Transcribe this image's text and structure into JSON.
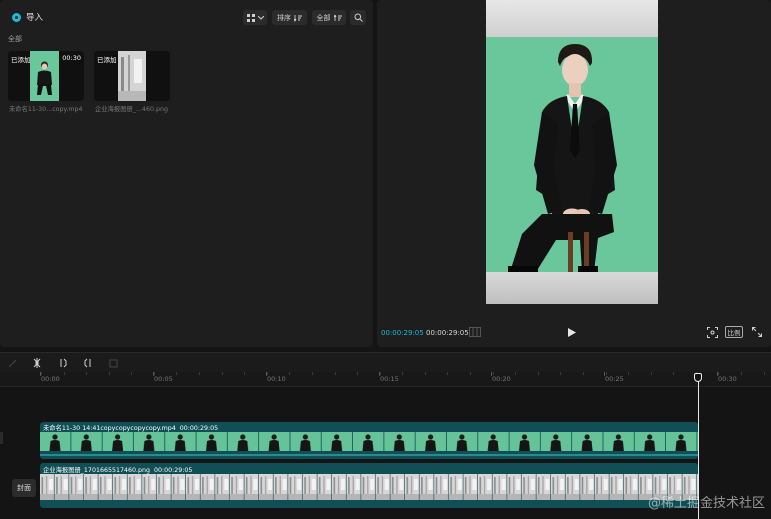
{
  "media": {
    "import_label": "导入",
    "sort_label": "排序",
    "filter_label": "全部",
    "all_label": "全部",
    "items": [
      {
        "badge": "已添加",
        "duration": "00:30",
        "name": "未命名11-30...copy.mp4"
      },
      {
        "badge": "已添加",
        "duration": "",
        "name": "企业海报图册_...460.png"
      }
    ]
  },
  "preview": {
    "current_time": "00:00:29:05",
    "total_time": "00:00:29:05",
    "ratio_label": "比例"
  },
  "timeline": {
    "ruler": [
      "00:00",
      "00:05",
      "00:10",
      "00:15",
      "00:20",
      "00:25",
      "00:30"
    ],
    "video_track": {
      "name": "未命名11-30 14:41copycopycopycopy.mp4",
      "duration": "00:00:29:05"
    },
    "image_track": {
      "name": "企业海报图册_1701665517460.png",
      "duration": "00:00:29:05"
    },
    "cover_label": "封面"
  },
  "watermark": "@稀土掘金技术社区",
  "colors": {
    "accent": "#1fb8d6",
    "track": "#0f4f55",
    "green_screen": "#6ac79c"
  }
}
